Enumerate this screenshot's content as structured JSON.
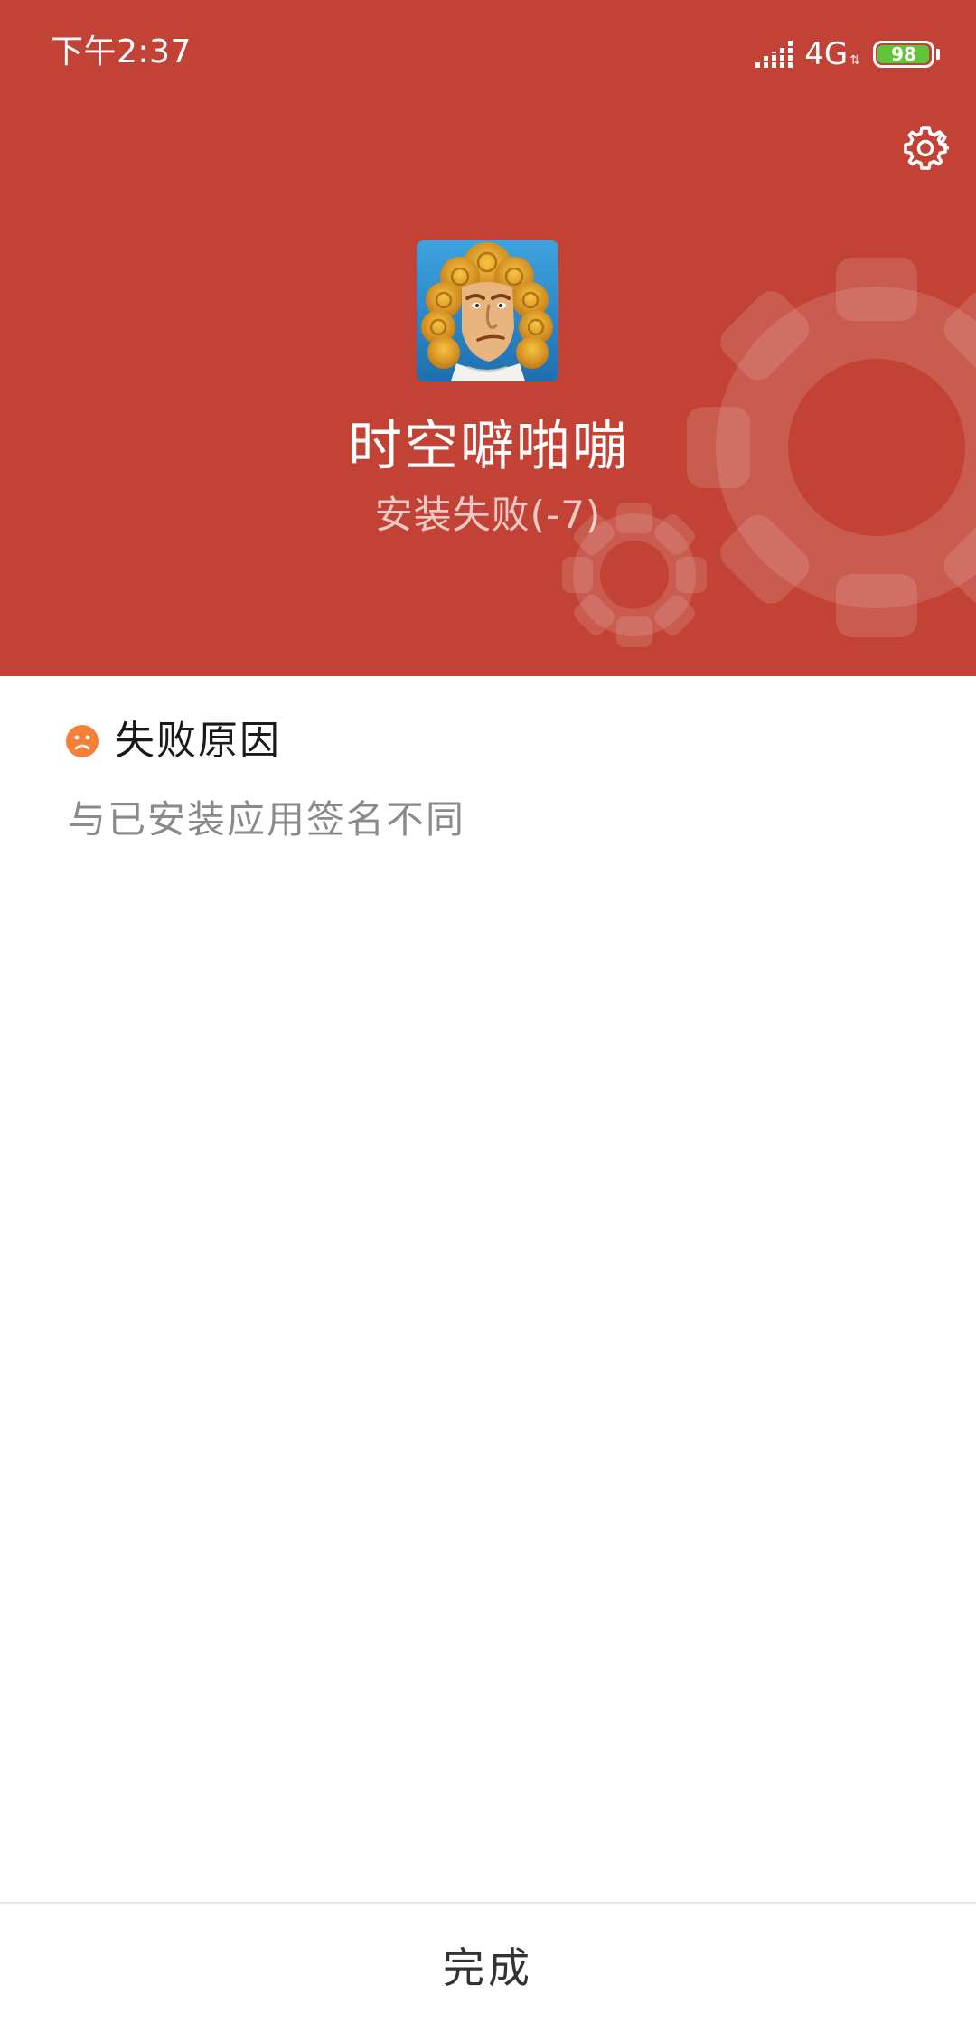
{
  "status_bar": {
    "time": "下午2:37",
    "network_type": "4G",
    "battery_level": "98",
    "battery_fraction": 0.98,
    "signal_icon": "signal-icon",
    "battery_color": "#5fc436"
  },
  "header": {
    "background_color": "#c24335",
    "settings_icon": "gear-icon",
    "app_name": "时空噼啪嘣",
    "install_status": "安装失败(-7)"
  },
  "failure": {
    "title": "失败原因",
    "icon": "sad-face-icon",
    "icon_color": "#f4803a",
    "reason": "与已安装应用签名不同"
  },
  "footer": {
    "done_label": "完成"
  }
}
